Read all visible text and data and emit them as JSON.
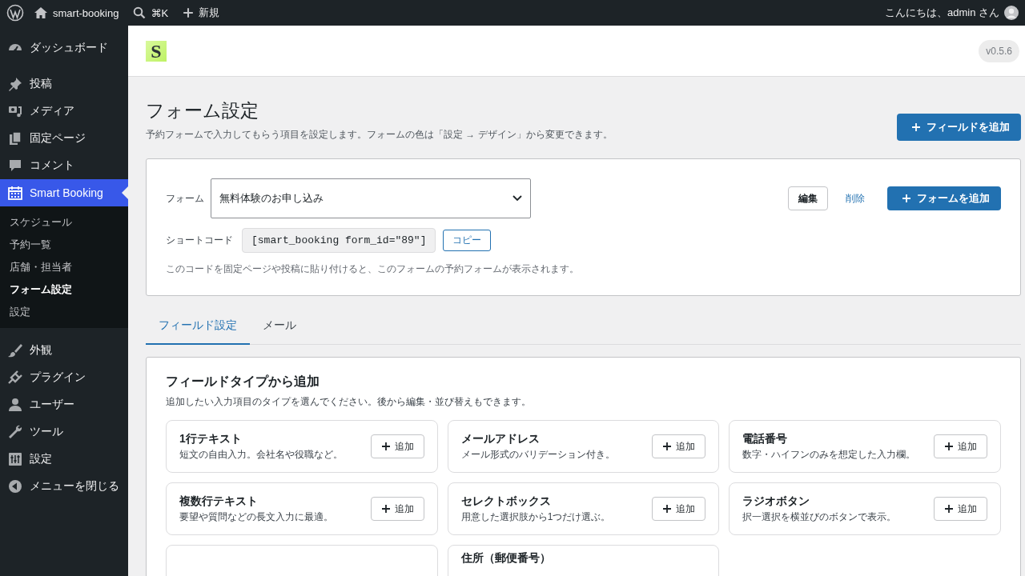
{
  "admin_bar": {
    "site_name": "smart-booking",
    "search_shortcut": "⌘K",
    "new_label": "新規",
    "greeting": "こんにちは、admin さん"
  },
  "sidebar": {
    "items": [
      {
        "label": "ダッシュボード",
        "selected": false
      },
      {
        "label": "投稿",
        "selected": false
      },
      {
        "label": "メディア",
        "selected": false
      },
      {
        "label": "固定ページ",
        "selected": false
      },
      {
        "label": "コメント",
        "selected": false
      },
      {
        "label": "Smart Booking",
        "selected": true,
        "children": [
          {
            "label": "スケジュール",
            "selected": false
          },
          {
            "label": "予約一覧",
            "selected": false
          },
          {
            "label": "店舗・担当者",
            "selected": false
          },
          {
            "label": "フォーム設定",
            "selected": true
          },
          {
            "label": "設定",
            "selected": false
          }
        ]
      },
      {
        "label": "外観",
        "selected": false
      },
      {
        "label": "プラグイン",
        "selected": false
      },
      {
        "label": "ユーザー",
        "selected": false
      },
      {
        "label": "ツール",
        "selected": false
      },
      {
        "label": "設定",
        "selected": false
      },
      {
        "label": "メニューを閉じる",
        "selected": false
      }
    ]
  },
  "header": {
    "logo": "S",
    "version": "v0.5.6"
  },
  "page": {
    "title": "フォーム設定",
    "description": "予約フォームで入力してもらう項目を設定します。フォームの色は「設定 → デザイン」から変更できます。",
    "add_field_button": "フィールドを追加"
  },
  "form_panel": {
    "form_label": "フォーム",
    "form_select": "無料体験のお申し込み",
    "edit_button": "編集",
    "delete_link": "削除",
    "add_form_button": "フォームを追加",
    "shortcode_label": "ショートコード",
    "shortcode": "[smart_booking form_id=\"89\"]",
    "copy_button": "コピー",
    "help": "このコードを固定ページや投稿に貼り付けると、このフォームの予約フォームが表示されます。"
  },
  "tabs": [
    {
      "label": "フィールド設定",
      "selected": true
    },
    {
      "label": "メール",
      "selected": false
    }
  ],
  "field_types": {
    "title": "フィールドタイプから追加",
    "description": "追加したい入力項目のタイプを選んでください。後から編集・並び替えもできます。",
    "items": [
      {
        "kind": "full",
        "title": "1行テキスト",
        "description": "短文の自由入力。会社名や役職など。",
        "add_button": "追加"
      },
      {
        "kind": "full",
        "title": "メールアドレス",
        "description": "メール形式のバリデーション付き。",
        "add_button": "追加"
      },
      {
        "kind": "full",
        "title": "電話番号",
        "description": "数字・ハイフンのみを想定した入力欄。",
        "add_button": "追加"
      },
      {
        "kind": "full",
        "title": "複数行テキスト",
        "description": "要望や質問などの長文入力に最適。",
        "add_button": "追加"
      },
      {
        "kind": "full",
        "title": "セレクトボックス",
        "description": "用意した選択肢から1つだけ選ぶ。",
        "add_button": "追加"
      },
      {
        "kind": "full",
        "title": "ラジオボタン",
        "description": "択一選択を横並びのボタンで表示。",
        "add_button": "追加"
      },
      {
        "kind": "cut"
      },
      {
        "kind": "cut",
        "title": "住所（郵便番号）"
      }
    ]
  }
}
